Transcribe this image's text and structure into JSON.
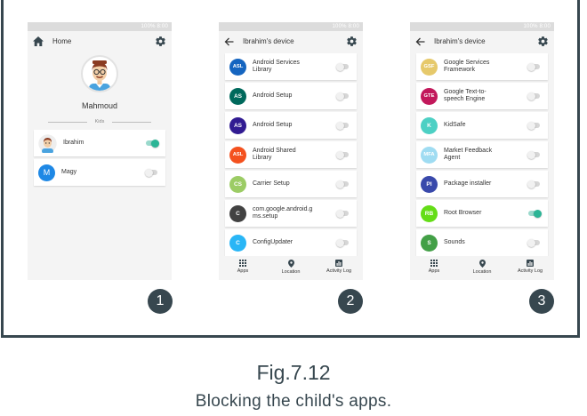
{
  "status_bar": "100% 8:00",
  "phone1": {
    "title": "Home",
    "parent_name": "Mahmoud",
    "section_label": "Kids",
    "kids": [
      {
        "name": "Ibrahim",
        "avatar": "",
        "color": "#ffffff",
        "toggle_on": true
      },
      {
        "name": "Magy",
        "avatar": "M",
        "color": "#1e88e5",
        "toggle_on": false
      }
    ]
  },
  "phone2": {
    "title": "Ibrahim's device",
    "apps": [
      {
        "abbr": "ASL",
        "name": "Android Services Library",
        "color": "#1565c0",
        "toggle_on": false
      },
      {
        "abbr": "AS",
        "name": "Android Setup",
        "color": "#00695c",
        "toggle_on": false
      },
      {
        "abbr": "AS",
        "name": "Android Setup",
        "color": "#311b92",
        "toggle_on": false
      },
      {
        "abbr": "ASL",
        "name": "Android Shared Library",
        "color": "#f4511e",
        "toggle_on": false
      },
      {
        "abbr": "CS",
        "name": "Carrier Setup",
        "color": "#9ccc65",
        "toggle_on": false
      },
      {
        "abbr": "C",
        "name": "com.google.android.gms.setup",
        "color": "#424242",
        "toggle_on": false
      },
      {
        "abbr": "C",
        "name": "ConfigUpdater",
        "color": "#29b6f6",
        "toggle_on": false
      }
    ]
  },
  "phone3": {
    "title": "Ibrahim's device",
    "apps": [
      {
        "abbr": "GSF",
        "name": "Google Services Framework",
        "color": "#e6c96b",
        "toggle_on": false
      },
      {
        "abbr": "GTE",
        "name": "Google Text-to-speech Engine",
        "color": "#c2185b",
        "toggle_on": false
      },
      {
        "abbr": "K",
        "name": "KidSafe",
        "color": "#4dd0c4",
        "toggle_on": false
      },
      {
        "abbr": "MFA",
        "name": "Market Feedback Agent",
        "color": "#9fdcf2",
        "toggle_on": false
      },
      {
        "abbr": "PI",
        "name": "Package installer",
        "color": "#3949ab",
        "toggle_on": false
      },
      {
        "abbr": "RB",
        "name": "Root Browser",
        "color": "#64dd17",
        "toggle_on": true
      },
      {
        "abbr": "S",
        "name": "Sounds",
        "color": "#43a047",
        "toggle_on": false
      }
    ]
  },
  "bottom_nav": {
    "apps": "Apps",
    "location": "Location",
    "activity_log": "Activity Log"
  },
  "badges": [
    "1",
    "2",
    "3"
  ],
  "caption": {
    "figure": "Fig.7.12",
    "text": "Blocking the child's apps."
  }
}
